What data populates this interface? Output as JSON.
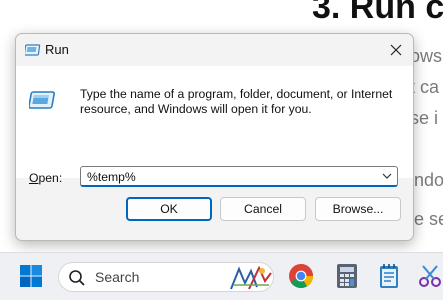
{
  "background": {
    "heading": "3. Run c",
    "lines": [
      "ows '",
      "t ca",
      "se i",
      "ndow",
      "e set"
    ]
  },
  "dialog": {
    "title": "Run",
    "description": "Type the name of a program, folder, document, or Internet resource, and Windows will open it for you.",
    "open_label_underlined": "O",
    "open_label_rest": "pen:",
    "open_value": "%temp%",
    "buttons": {
      "ok": "OK",
      "cancel": "Cancel",
      "browse": "Browse..."
    },
    "icons": {
      "title": "run-icon",
      "close": "close-icon",
      "body": "run-icon",
      "combo": "chevron-down-icon"
    }
  },
  "taskbar": {
    "search_label": "Search",
    "icons": [
      "windows-start-icon",
      "search-icon",
      "chrome-icon",
      "calculator-icon",
      "notepad-icon",
      "snipping-tool-icon"
    ],
    "colors": {
      "accent": "#0067c0",
      "windows_blue": "#0078d4"
    }
  }
}
